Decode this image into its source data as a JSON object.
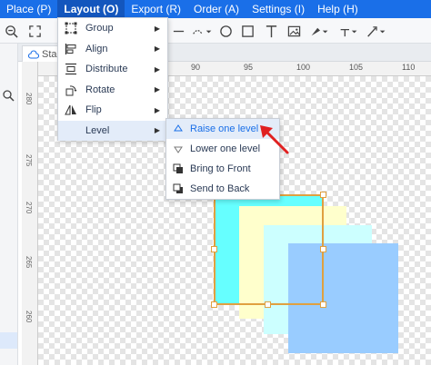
{
  "menubar": {
    "items": [
      {
        "label": "Place (P)"
      },
      {
        "label": "Layout (O)"
      },
      {
        "label": "Export (R)"
      },
      {
        "label": "Order (A)"
      },
      {
        "label": "Settings (I)"
      },
      {
        "label": "Help (H)"
      }
    ],
    "active_index": 1,
    "color": "#1a6fe8"
  },
  "tab": {
    "label": "Sta"
  },
  "ruler": {
    "horizontal": [
      "90",
      "95",
      "100",
      "105",
      "110"
    ],
    "vertical": [
      "280",
      "275",
      "270",
      "265",
      "260"
    ]
  },
  "layout_menu": {
    "items": [
      {
        "label": "Group",
        "icon": "group-icon",
        "has_submenu": true
      },
      {
        "label": "Align",
        "icon": "align-icon",
        "has_submenu": true
      },
      {
        "label": "Distribute",
        "icon": "distribute-icon",
        "has_submenu": true
      },
      {
        "label": "Rotate",
        "icon": "rotate-icon",
        "has_submenu": true
      },
      {
        "label": "Flip",
        "icon": "flip-icon",
        "has_submenu": true
      },
      {
        "label": "Level",
        "icon": "",
        "has_submenu": true
      }
    ],
    "highlighted": "Level"
  },
  "level_submenu": {
    "items": [
      {
        "label": "Raise one level",
        "icon": "raise-level-icon"
      },
      {
        "label": "Lower one level",
        "icon": "lower-level-icon"
      },
      {
        "label": "Bring to Front",
        "icon": "bring-front-icon"
      },
      {
        "label": "Send to Back",
        "icon": "send-back-icon"
      }
    ],
    "highlighted": "Raise one level"
  },
  "colors": {
    "accent": "#1a6fe8",
    "selection": "#e0a040",
    "annotation_arrow": "#e02020",
    "shape_cyan": "#66ffff",
    "shape_yellow": "#ffffcc",
    "shape_lightcyan": "#ccffff",
    "shape_blue": "#99ccff"
  }
}
